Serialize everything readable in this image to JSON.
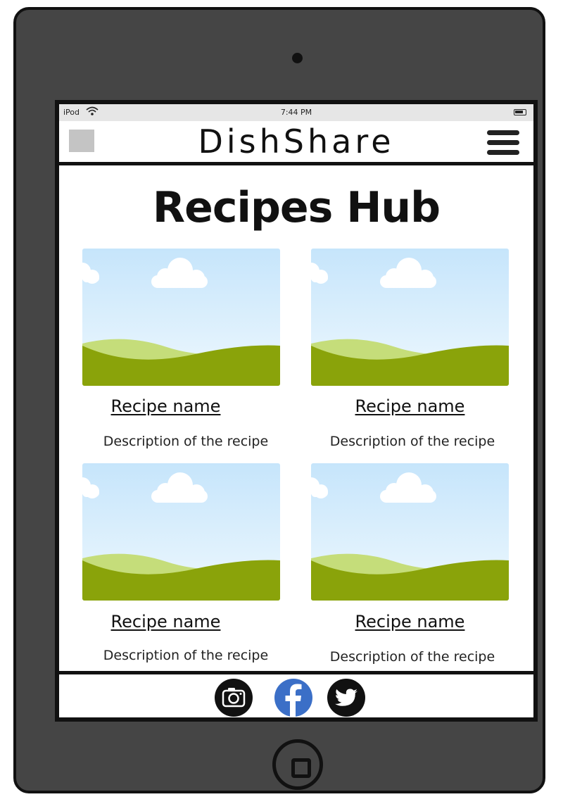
{
  "status_bar": {
    "carrier": "iPod",
    "time": "7:44 PM"
  },
  "header": {
    "brand": "DishShare"
  },
  "main": {
    "title": "Recipes Hub",
    "cards": [
      {
        "name": "Recipe name",
        "description": "Description of the recipe"
      },
      {
        "name": "Recipe name",
        "description": "Description of the recipe"
      },
      {
        "name": "Recipe name",
        "description": "Description of the recipe"
      },
      {
        "name": "Recipe name",
        "description": "Description of the recipe"
      }
    ]
  },
  "footer": {
    "social": [
      {
        "icon": "camera-icon"
      },
      {
        "icon": "facebook-icon"
      },
      {
        "icon": "twitter-icon"
      }
    ]
  },
  "colors": {
    "device_body": "#454545",
    "status_bar": "#e6e6e6",
    "facebook_blue": "#3b6fc7",
    "sky": "#cde9fb",
    "grass": "#8aa30a"
  }
}
